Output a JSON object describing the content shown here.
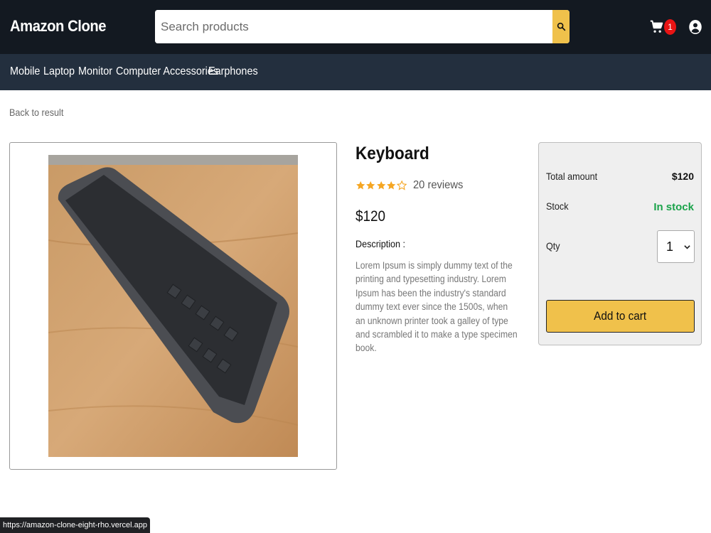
{
  "header": {
    "logo": "Amazon Clone",
    "search_placeholder": "Search products",
    "cart_count": "1"
  },
  "categories": [
    "Mobile",
    "Laptop",
    "Monitor",
    "Computer Accessories",
    "Earphones"
  ],
  "back_link": "Back to result",
  "product": {
    "title": "Keyboard",
    "rating": 4,
    "rating_max": 5,
    "reviews": "20 reviews",
    "price": "$120",
    "description_label": "Description :",
    "description": "Lorem Ipsum is simply dummy text of the printing and typesetting industry. Lorem Ipsum has been the industry's standard dummy text ever since the 1500s, when an unknown printer took a galley of type and scrambled it to make a type specimen book."
  },
  "buy_box": {
    "total_label": "Total amount",
    "total_value": "$120",
    "stock_label": "Stock",
    "stock_value": "In stock",
    "qty_label": "Qty",
    "qty_value": "1",
    "add_to_cart": "Add to cart"
  },
  "status_url": "https://amazon-clone-eight-rho.vercel.app",
  "colors": {
    "header_bg": "#131921",
    "nav_bg": "#232f3e",
    "accent": "#f0c14b",
    "badge": "#e81414",
    "stock": "#1aa34a",
    "star": "#f5a623"
  }
}
